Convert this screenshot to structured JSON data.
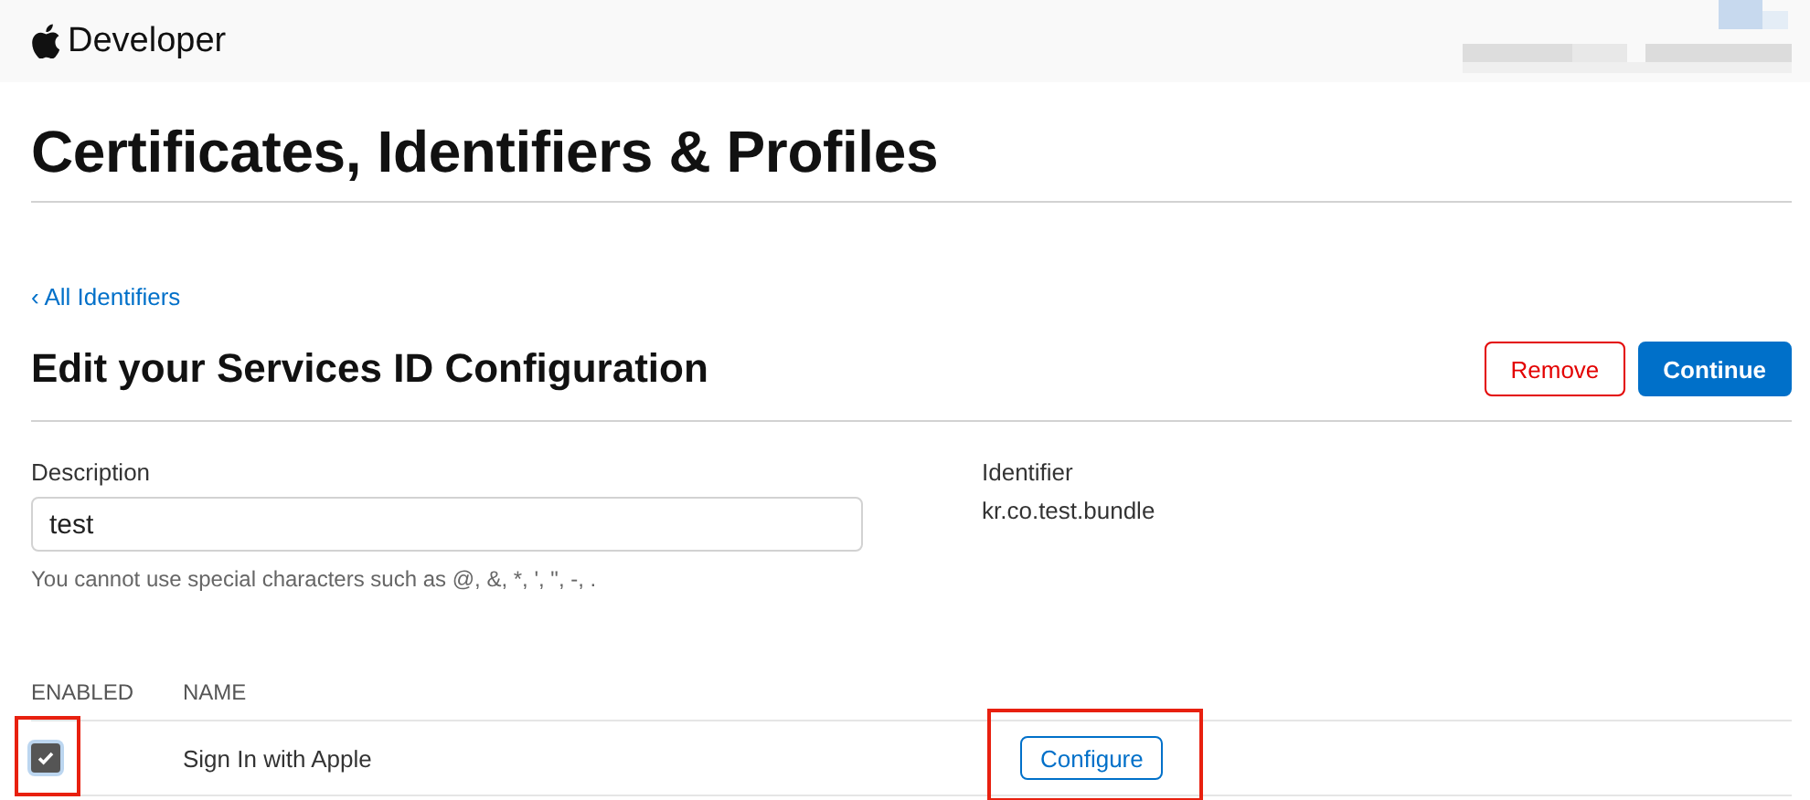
{
  "header": {
    "brand": "Developer",
    "account_redacted": true
  },
  "page_title": "Certificates, Identifiers & Profiles",
  "back_link": "‹ All Identifiers",
  "section_title": "Edit your Services ID Configuration",
  "buttons": [
    {
      "label": "Remove",
      "kind": "secondary"
    },
    {
      "label": "Continue",
      "kind": "primary"
    }
  ],
  "fields": [
    {
      "label": "Description",
      "kind": "input",
      "value": "test",
      "hint": "You cannot use special characters such as @, &, *, ', \", -, ."
    },
    {
      "label": "Identifier",
      "kind": "static",
      "value": "kr.co.test.bundle"
    }
  ],
  "table": {
    "columns": [
      "ENABLED",
      "NAME"
    ],
    "rows": [
      {
        "enabled": true,
        "name": "Sign In with Apple",
        "action": "Configure",
        "checkbox_highlighted": true,
        "action_highlighted": true
      }
    ]
  }
}
